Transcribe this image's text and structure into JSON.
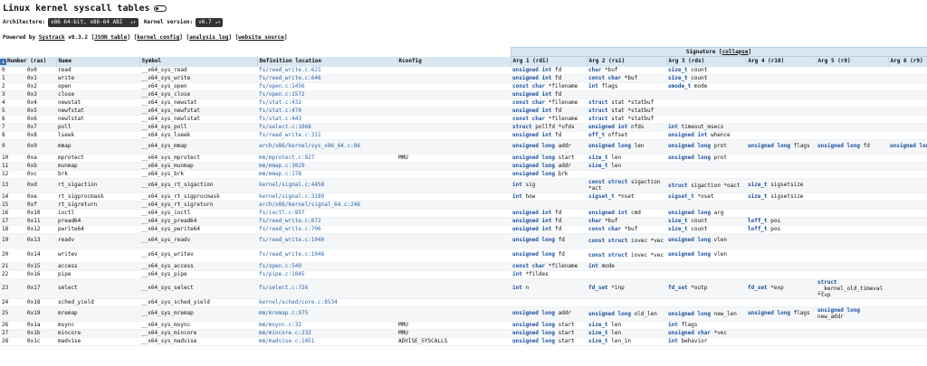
{
  "title": "Linux kernel syscall tables",
  "controls": {
    "arch_label": "Architecture:",
    "arch_value": "x86 64-bit, x86-64 ABI",
    "kernel_label": "Kernel version:",
    "kernel_value": "v6.7"
  },
  "powered": {
    "prefix": "Powered by",
    "tool": "Systrack",
    "version": "v0.3.2",
    "links": [
      "JSON table",
      "kernel config",
      "analysis log",
      "website source"
    ]
  },
  "signature": {
    "label": "Signature",
    "collapse": "collapse"
  },
  "columns": [
    "Number (rax)",
    "",
    "Name",
    "Symbol",
    "Definition location",
    "Kconfig",
    "Arg 1 (rdi)",
    "Arg 2 (rsi)",
    "Arg 3 (rdx)",
    "Arg 4 (r10)",
    "Arg 5 (r8)",
    "Arg 6 (r9)"
  ],
  "rows": [
    [
      "0",
      "0x0",
      "read",
      "__x64_sys_read",
      "fs/read_write.c:621",
      "",
      "unsigned int fd",
      "char *buf",
      "size_t count",
      "",
      "",
      ""
    ],
    [
      "1",
      "0x1",
      "write",
      "__x64_sys_write",
      "fs/read_write.c:646",
      "",
      "unsigned int fd",
      "const char *buf",
      "size_t count",
      "",
      "",
      ""
    ],
    [
      "2",
      "0x2",
      "open",
      "__x64_sys_open",
      "fs/open.c:1456",
      "",
      "const char *filename",
      "int flags",
      "umode_t mode",
      "",
      "",
      ""
    ],
    [
      "3",
      "0x3",
      "close",
      "__x64_sys_close",
      "fs/open.c:1572",
      "",
      "unsigned int fd",
      "",
      "",
      "",
      "",
      ""
    ],
    [
      "4",
      "0x4",
      "newstat",
      "__x64_sys_newstat",
      "fs/stat.c:432",
      "",
      "const char *filename",
      "struct stat *statbuf",
      "",
      "",
      "",
      ""
    ],
    [
      "5",
      "0x5",
      "newfstat",
      "__x64_sys_newfstat",
      "fs/stat.c:470",
      "",
      "unsigned int fd",
      "struct stat *statbuf",
      "",
      "",
      "",
      ""
    ],
    [
      "6",
      "0x6",
      "newlstat",
      "__x64_sys_newlstat",
      "fs/stat.c:443",
      "",
      "const char *filename",
      "struct stat *statbuf",
      "",
      "",
      "",
      ""
    ],
    [
      "7",
      "0x7",
      "poll",
      "__x64_sys_poll",
      "fs/select.c:1068",
      "",
      "struct pollfd *ufds",
      "unsigned int nfds",
      "int timeout_msecs",
      "",
      "",
      ""
    ],
    [
      "8",
      "0x8",
      "lseek",
      "__x64_sys_lseek",
      "fs/read_write.c:311",
      "",
      "unsigned int fd",
      "off_t offset",
      "unsigned int whence",
      "",
      "",
      ""
    ],
    [
      "9",
      "0x9",
      "mmap",
      "__x64_sys_mmap",
      "arch/x86/kernel/sys_x86_64.c:86",
      "",
      "unsigned long addr",
      "unsigned long len",
      "unsigned long prot",
      "unsigned long flags",
      "unsigned long fd",
      "unsigned long off"
    ],
    [
      "10",
      "0xa",
      "mprotect",
      "__x64_sys_mprotect",
      "mm/mprotect.c:827",
      "MMU",
      "unsigned long start",
      "size_t len",
      "unsigned long prot",
      "",
      "",
      ""
    ],
    [
      "11",
      "0xb",
      "munmap",
      "__x64_sys_munmap",
      "mm/mmap.c:3029",
      "",
      "unsigned long addr",
      "size_t len",
      "",
      "",
      "",
      ""
    ],
    [
      "12",
      "0xc",
      "brk",
      "__x64_sys_brk",
      "mm/mmap.c:178",
      "",
      "unsigned long brk",
      "",
      "",
      "",
      "",
      ""
    ],
    [
      "13",
      "0xd",
      "rt_sigaction",
      "__x64_sys_rt_sigaction",
      "kernel/signal.c:4458",
      "",
      "int sig",
      "const struct sigaction *act",
      "struct sigaction *oact",
      "size_t sigsetsize",
      "",
      ""
    ],
    [
      "14",
      "0xe",
      "rt_sigprocmask",
      "__x64_sys_rt_sigprocmask",
      "kernel/signal.c:3189",
      "",
      "int how",
      "sigset_t *nset",
      "sigset_t *oset",
      "size_t sigsetsize",
      "",
      ""
    ],
    [
      "15",
      "0xf",
      "rt_sigreturn",
      "__x64_sys_rt_sigreturn",
      "arch/x86/kernel/signal_64.c:246",
      "",
      "",
      "",
      "",
      "",
      "",
      ""
    ],
    [
      "16",
      "0x10",
      "ioctl",
      "__x64_sys_ioctl",
      "fs/ioctl.c:857",
      "",
      "unsigned int fd",
      "unsigned int cmd",
      "unsigned long arg",
      "",
      "",
      ""
    ],
    [
      "17",
      "0x11",
      "pread64",
      "__x64_sys_pread64",
      "fs/read_write.c:672",
      "",
      "unsigned int fd",
      "char *buf",
      "size_t count",
      "loff_t pos",
      "",
      ""
    ],
    [
      "18",
      "0x12",
      "pwrite64",
      "__x64_sys_pwrite64",
      "fs/read_write.c:706",
      "",
      "unsigned int fd",
      "const char *buf",
      "size_t count",
      "loff_t pos",
      "",
      ""
    ],
    [
      "19",
      "0x13",
      "readv",
      "__x64_sys_readv",
      "fs/read_write.c:1040",
      "",
      "unsigned long fd",
      "const struct iovec *vec",
      "unsigned long vlen",
      "",
      "",
      ""
    ],
    [
      "20",
      "0x14",
      "writev",
      "__x64_sys_writev",
      "fs/read_write.c:1046",
      "",
      "unsigned long fd",
      "const struct iovec *vec",
      "unsigned long vlen",
      "",
      "",
      ""
    ],
    [
      "21",
      "0x15",
      "access",
      "__x64_sys_access",
      "fs/open.c:540",
      "",
      "const char *filename",
      "int mode",
      "",
      "",
      "",
      ""
    ],
    [
      "22",
      "0x16",
      "pipe",
      "__x64_sys_pipe",
      "fs/pipe.c:1045",
      "",
      "int *fildes",
      "",
      "",
      "",
      "",
      ""
    ],
    [
      "23",
      "0x17",
      "select",
      "__x64_sys_select",
      "fs/select.c:726",
      "",
      "int n",
      "fd_set *inp",
      "fd_set *outp",
      "fd_set *exp",
      "struct __kernel_old_timeval *tvp",
      ""
    ],
    [
      "24",
      "0x18",
      "sched_yield",
      "__x64_sys_sched_yield",
      "kernel/sched/core.c:8534",
      "",
      "",
      "",
      "",
      "",
      "",
      ""
    ],
    [
      "25",
      "0x19",
      "mremap",
      "__x64_sys_mremap",
      "mm/mremap.c:975",
      "",
      "unsigned long addr",
      "unsigned long old_len",
      "unsigned long new_len",
      "unsigned long flags",
      "unsigned long new_addr",
      ""
    ],
    [
      "26",
      "0x1a",
      "msync",
      "__x64_sys_msync",
      "mm/msync.c:32",
      "MMU",
      "unsigned long start",
      "size_t len",
      "int flags",
      "",
      "",
      ""
    ],
    [
      "27",
      "0x1b",
      "mincore",
      "__x64_sys_mincore",
      "mm/mincore.c:232",
      "MMU",
      "unsigned long start",
      "size_t len",
      "unsigned char *vec",
      "",
      "",
      ""
    ],
    [
      "28",
      "0x1c",
      "madvise",
      "__x64_sys_madvise",
      "mm/madvise.c:1451",
      "ADVISE_SYSCALLS",
      "unsigned long start",
      "size_t len_in",
      "int behavior",
      "",
      "",
      ""
    ]
  ]
}
